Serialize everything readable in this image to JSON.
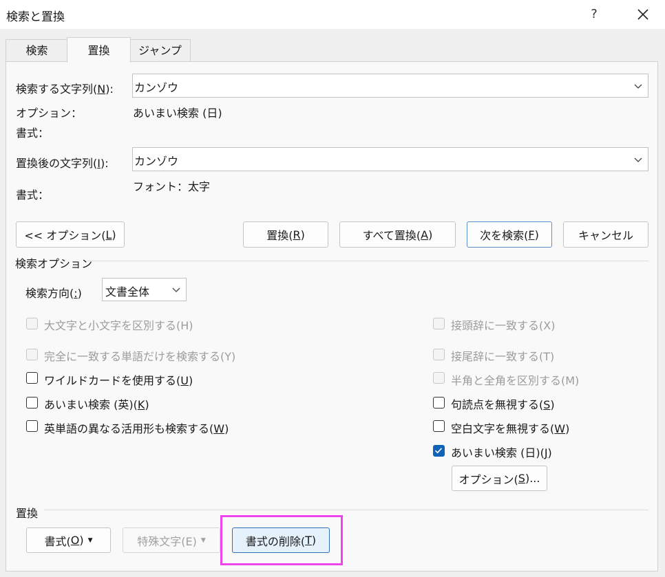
{
  "window": {
    "title": "検索と置換",
    "help_label": "?"
  },
  "tabs": [
    {
      "label": "検索"
    },
    {
      "label": "置換"
    },
    {
      "label": "ジャンプ"
    }
  ],
  "find": {
    "label": "検索する文字列(N):",
    "value": "カンゾウ"
  },
  "options_row": {
    "label": "オプション：",
    "value": "あいまい検索 (日)"
  },
  "find_format_label": "書式：",
  "replace": {
    "label": "置換後の文字列(I):",
    "value": "カンゾウ"
  },
  "replace_format": {
    "label": "書式：",
    "value": "フォント：太字"
  },
  "buttons": {
    "options_toggle": "<< オプション(L)",
    "replace": "置換(R)",
    "replace_all": "すべて置換(A)",
    "find_next": "次を検索(F)",
    "cancel": "キャンセル"
  },
  "search_options": {
    "section_title": "検索オプション",
    "direction_label": "検索方向(:)",
    "direction_value": "文書全体",
    "left_checkboxes": [
      {
        "label": "大文字と小文字を区別する(H)",
        "checked": false,
        "disabled": true
      },
      {
        "label": "完全に一致する単語だけを検索する(Y)",
        "checked": false,
        "disabled": true
      },
      {
        "label": "ワイルドカードを使用する(U)",
        "checked": false,
        "disabled": false
      },
      {
        "label": "あいまい検索 (英)(K)",
        "checked": false,
        "disabled": false
      },
      {
        "label": "英単語の異なる活用形も検索する(W)",
        "checked": false,
        "disabled": false
      }
    ],
    "right_checkboxes": [
      {
        "label": "接頭辞に一致する(X)",
        "checked": false,
        "disabled": true
      },
      {
        "label": "接尾辞に一致する(T)",
        "checked": false,
        "disabled": true
      },
      {
        "label": "半角と全角を区別する(M)",
        "checked": false,
        "disabled": true
      },
      {
        "label": "句読点を無視する(S)",
        "checked": false,
        "disabled": false
      },
      {
        "label": "空白文字を無視する(W)",
        "checked": false,
        "disabled": false
      },
      {
        "label": "あいまい検索 (日)(J)",
        "checked": true,
        "disabled": false
      }
    ],
    "fuzzy_options_button": "オプション(S)..."
  },
  "replace_section": {
    "title": "置換",
    "format_button": "書式(O)",
    "special_button": "特殊文字(E)",
    "clear_format_button": "書式の削除(T)"
  },
  "colors": {
    "accent": "#0f62b8",
    "highlight": "#ee44ee"
  }
}
